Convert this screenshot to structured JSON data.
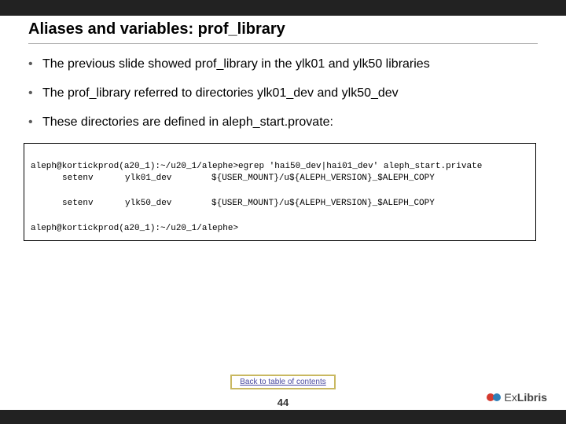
{
  "title": "Aliases and variables: prof_library",
  "bullets": [
    "The previous slide showed prof_library in the ylk01 and ylk50 libraries",
    "The prof_library referred to directories ylk01_dev and ylk50_dev",
    "These directories are defined in aleph_start.provate:"
  ],
  "code": {
    "line1": "aleph@kortickprod(a20_1):~/u20_1/alephe>egrep 'hai50_dev|hai01_dev' aleph_start.private",
    "rows": [
      {
        "cmd": "setenv",
        "var": "ylk01_dev",
        "val": "${USER_MOUNT}/u${ALEPH_VERSION}_$ALEPH_COPY"
      },
      {
        "cmd": "setenv",
        "var": "ylk50_dev",
        "val": "${USER_MOUNT}/u${ALEPH_VERSION}_$ALEPH_COPY"
      }
    ],
    "line_last": "aleph@kortickprod(a20_1):~/u20_1/alephe>"
  },
  "toc_label": "Back to table of contents",
  "page_number": "44",
  "logo": {
    "prefix": "Ex",
    "suffix": "Libris"
  }
}
